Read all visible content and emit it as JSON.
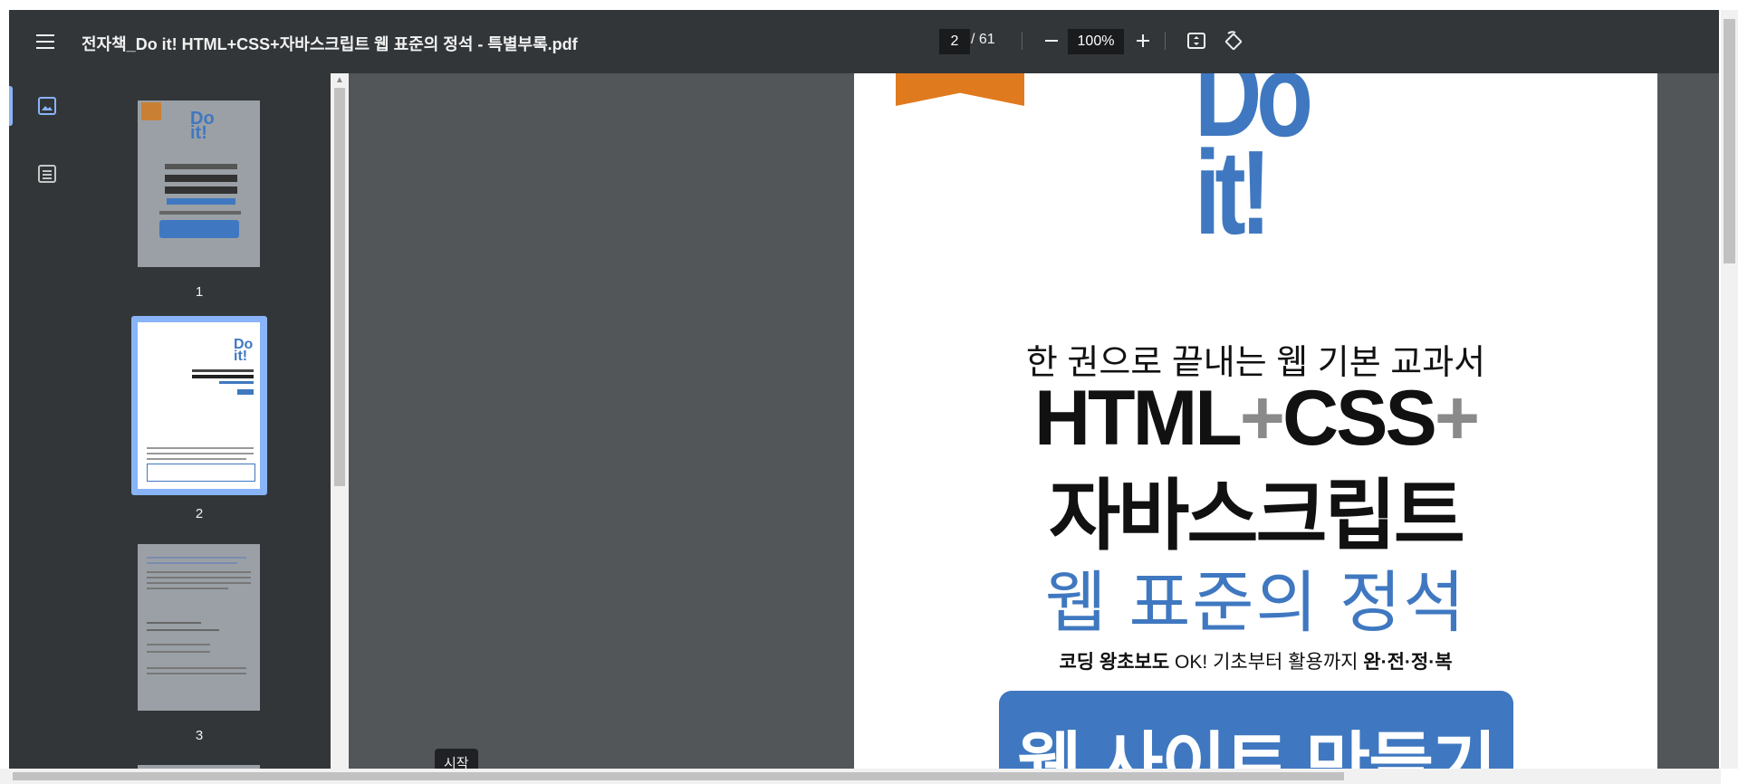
{
  "toolbar": {
    "title": "전자책_Do it! HTML+CSS+자바스크립트 웹 표준의 정석 - 특별부록.pdf",
    "current_page": "2",
    "page_total": "/ 61",
    "zoom": "100%",
    "icons": [
      "menu-icon",
      "zoom-out-icon",
      "zoom-in-icon",
      "fit-page-icon",
      "rotate-icon"
    ]
  },
  "sidebar": {
    "rail_icons": [
      "thumbnails-icon",
      "outline-icon"
    ],
    "thumbnails": [
      {
        "label": "1"
      },
      {
        "label": "2",
        "selected": true
      },
      {
        "label": "3"
      }
    ]
  },
  "page": {
    "logo_line1": "Do",
    "logo_line2": "it!",
    "subtitle": "한 권으로 끝내는 웹 기본 교과서",
    "heading_html": "HTML",
    "heading_css": "CSS",
    "plus": "+",
    "heading_js": "자바스크립트",
    "heading_blue": "웹 표준의 정석",
    "tagline_bold1": "코딩 왕초보도",
    "tagline_ok": " OK! ",
    "tagline_mid": "기초부터 활용까지 ",
    "tagline_bold2": "완·전·정·복",
    "banner": "웹 사이트 만들기"
  },
  "tooltip": "시작",
  "colors": {
    "toolbar_bg": "#323639",
    "viewer_bg": "#525659",
    "accent_blue": "#3f78c0",
    "ribbon_orange": "#e07a1f",
    "selection_blue": "#8ab4f8"
  }
}
